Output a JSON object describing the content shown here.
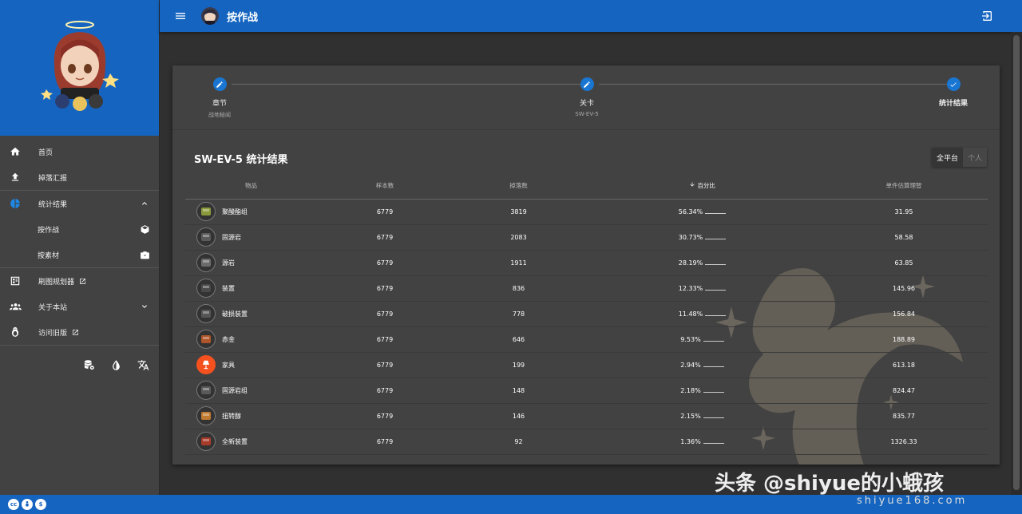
{
  "topbar": {
    "title": "按作战"
  },
  "sidebar": {
    "items": [
      {
        "label": "首页",
        "icon": "home-icon"
      },
      {
        "label": "掉落汇报",
        "icon": "upload-icon"
      },
      {
        "label": "统计结果",
        "icon": "pie-chart-icon"
      },
      {
        "label": "按作战",
        "icon": "cube-icon"
      },
      {
        "label": "按素材",
        "icon": "box-icon"
      },
      {
        "label": "刷图规划器",
        "icon": "planner-icon"
      },
      {
        "label": "关于本站",
        "icon": "people-icon"
      },
      {
        "label": "访问旧版",
        "icon": "penguin-icon"
      }
    ],
    "tools": [
      "database-settings-icon",
      "contrast-icon",
      "translate-icon"
    ]
  },
  "stepper": {
    "steps": [
      {
        "label": "章节",
        "sub": "战地秘闻"
      },
      {
        "label": "关卡",
        "sub": "SW-EV-5"
      },
      {
        "label": "统计结果",
        "sub": ""
      }
    ]
  },
  "results": {
    "title": "SW-EV-5 统计结果",
    "toggle": {
      "all": "全平台",
      "personal": "个人"
    },
    "columns": [
      "物品",
      "样本数",
      "掉落数",
      "百分比",
      "单件估算理智"
    ],
    "rows": [
      {
        "item": "聚酸酯组",
        "samples": "6779",
        "drops": "3819",
        "percent": "56.34%",
        "sanity": "31.95",
        "color": "#8a9a3a"
      },
      {
        "item": "固源岩",
        "samples": "6779",
        "drops": "2083",
        "percent": "30.73%",
        "sanity": "58.58",
        "color": "#5a5a5a"
      },
      {
        "item": "源岩",
        "samples": "6779",
        "drops": "1911",
        "percent": "28.19%",
        "sanity": "63.85",
        "color": "#6b6b6b"
      },
      {
        "item": "装置",
        "samples": "6779",
        "drops": "836",
        "percent": "12.33%",
        "sanity": "145.96",
        "color": "#4a4a4a"
      },
      {
        "item": "破损装置",
        "samples": "6779",
        "drops": "778",
        "percent": "11.48%",
        "sanity": "156.84",
        "color": "#555555"
      },
      {
        "item": "赤金",
        "samples": "6779",
        "drops": "646",
        "percent": "9.53%",
        "sanity": "188.89",
        "color": "#b0552a"
      },
      {
        "item": "家具",
        "samples": "6779",
        "drops": "199",
        "percent": "2.94%",
        "sanity": "613.18",
        "color": "#f4511e"
      },
      {
        "item": "固源岩组",
        "samples": "6779",
        "drops": "148",
        "percent": "2.18%",
        "sanity": "824.47",
        "color": "#5a5a5a"
      },
      {
        "item": "扭转醇",
        "samples": "6779",
        "drops": "146",
        "percent": "2.15%",
        "sanity": "835.77",
        "color": "#c07a30"
      },
      {
        "item": "全新装置",
        "samples": "6779",
        "drops": "92",
        "percent": "1.36%",
        "sanity": "1326.33",
        "color": "#a83a2a"
      }
    ]
  },
  "footer": {
    "license": [
      "cc",
      "by",
      "nc"
    ]
  },
  "overlay": {
    "watermark": "头条 @shiyue的小蛾孩",
    "url": "shiyue168.com"
  }
}
